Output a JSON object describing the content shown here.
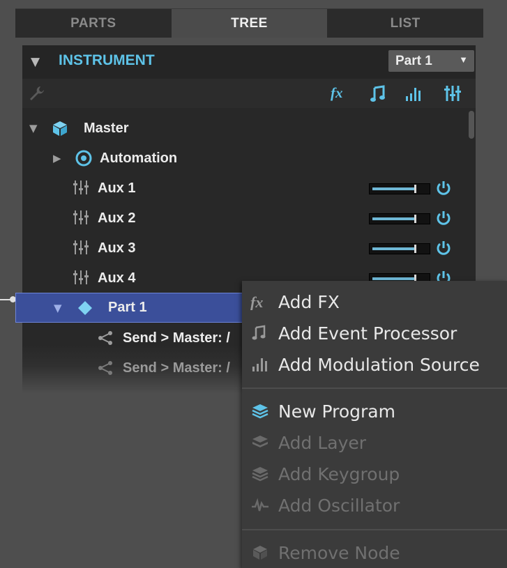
{
  "tabs": [
    {
      "label": "PARTS",
      "active": false
    },
    {
      "label": "TREE",
      "active": true
    },
    {
      "label": "LIST",
      "active": false
    }
  ],
  "instrument": {
    "title": "INSTRUMENT",
    "part_select": "Part 1"
  },
  "toolbar": {
    "icons": [
      "wrench-icon",
      "fx-icon",
      "note-icon",
      "bars-icon",
      "mixer-icon"
    ],
    "fx_label": "fx"
  },
  "tree": {
    "master": "Master",
    "automation": "Automation",
    "aux": [
      {
        "label": "Aux 1",
        "level": 0.8
      },
      {
        "label": "Aux 2",
        "level": 0.8
      },
      {
        "label": "Aux 3",
        "level": 0.8
      },
      {
        "label": "Aux 4",
        "level": 0.8
      }
    ],
    "part": "Part 1",
    "sends": [
      "Send > Master: /",
      "Send > Master: /"
    ]
  },
  "menu": {
    "items": [
      {
        "label": "Add FX",
        "icon": "fx-icon",
        "enabled": true
      },
      {
        "label": "Add Event Processor",
        "icon": "note-icon",
        "enabled": true
      },
      {
        "label": "Add Modulation Source",
        "icon": "bars-icon",
        "enabled": true
      },
      {
        "label": "New Program",
        "icon": "layers-icon",
        "enabled": true
      },
      {
        "label": "Add Layer",
        "icon": "layer-icon",
        "enabled": false
      },
      {
        "label": "Add Keygroup",
        "icon": "keygroup-icon",
        "enabled": false
      },
      {
        "label": "Add Oscillator",
        "icon": "waveform-icon",
        "enabled": false
      },
      {
        "label": "Remove Node",
        "icon": "cube-icon",
        "enabled": false
      }
    ]
  },
  "colors": {
    "accent": "#5ec3e8",
    "selection": "#3b4f9a",
    "menu_bg": "#3b3b3b"
  }
}
